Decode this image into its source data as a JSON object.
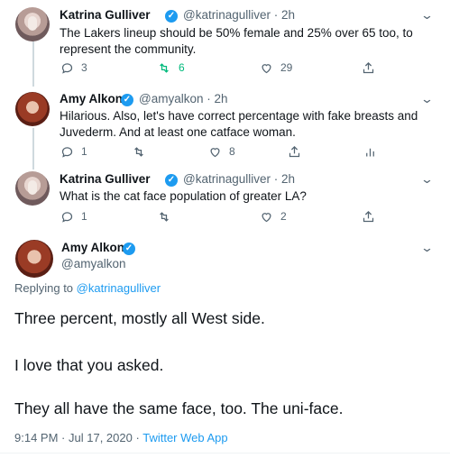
{
  "tweets": [
    {
      "name": "Katrina Gulliver",
      "handle": "@katrinagulliver",
      "sep": "·",
      "time": "2h",
      "text_lines": [
        "The Lakers lineup should be 50% female and 25% over 65 too, to",
        "represent the community."
      ],
      "replies": "3",
      "retweets": "6",
      "likes": "29"
    },
    {
      "name": "Amy Alkon",
      "handle": "@amyalkon",
      "sep": "·",
      "time": "2h",
      "text_lines": [
        "Hilarious. Also, let's have correct percentage with fake breasts and",
        "Juvederm. And at least one catface woman."
      ],
      "replies": "1",
      "retweets": "",
      "likes": "8"
    },
    {
      "name": "Katrina Gulliver",
      "handle": "@katrinagulliver",
      "sep": "·",
      "time": "2h",
      "text_lines": [
        "What is the cat face population of greater LA?"
      ],
      "replies": "1",
      "retweets": "",
      "likes": "2"
    }
  ],
  "main": {
    "name": "Amy Alkon",
    "handle": "@amyalkon",
    "replying_prefix": "Replying to",
    "replying_to": "@katrinagulliver",
    "paragraphs": [
      "Three percent, mostly all West side.",
      "I love that you asked.",
      "They all have the same face, too. The uni-face."
    ],
    "time": "9:14 PM",
    "sep": "·",
    "date": "Jul 17, 2020",
    "app": "Twitter Web App"
  },
  "colors": {
    "accent": "#1d9bf0",
    "retweet_active": "#00ba7c",
    "muted": "#536471"
  },
  "icons": [
    "reply-icon",
    "retweet-icon",
    "like-icon",
    "share-icon",
    "analytics-icon",
    "verified-badge-icon",
    "chevron-down-icon"
  ]
}
